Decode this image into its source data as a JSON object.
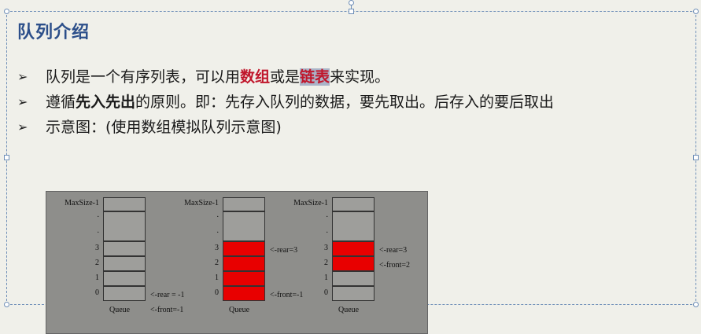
{
  "slide": {
    "title": "队列介绍",
    "bullet1": {
      "part1": "队列是一个有序列表，可以用",
      "kw1": "数组",
      "part2": "或是",
      "kw2": "链表",
      "part3": "来实现。"
    },
    "bullet2": {
      "part1": "遵循",
      "kw": "先入先出",
      "part2": "的原则。即：先存入队列的数据，要先取出。后存入的要后取出"
    },
    "bullet3": {
      "text": "示意图：(使用数组模拟队列示意图)"
    },
    "bullet_marker": "➢"
  },
  "diagram": {
    "row_labels": [
      "MaxSize-1",
      ".",
      ".",
      "3",
      "2",
      "1",
      "0"
    ],
    "bottom_label": "Queue",
    "queues": [
      {
        "filled_indices": [],
        "annotations": [
          {
            "text": "<-rear = -1",
            "row": "0"
          },
          {
            "text": "<-front=-1",
            "row": "below"
          }
        ]
      },
      {
        "filled_indices": [
          0,
          1,
          2,
          3
        ],
        "annotations": [
          {
            "text": "<-rear=3",
            "row": "3"
          },
          {
            "text": "<-front=-1",
            "row": "0"
          }
        ]
      },
      {
        "filled_indices": [
          2,
          3
        ],
        "annotations": [
          {
            "text": "<-rear=3",
            "row": "3"
          },
          {
            "text": "<-front=2",
            "row": "2"
          }
        ]
      }
    ]
  },
  "colors": {
    "title": "#2c4f8a",
    "keyword": "#c0162b",
    "queue_filled": "#e80000",
    "selection": "#6f8fb8"
  }
}
